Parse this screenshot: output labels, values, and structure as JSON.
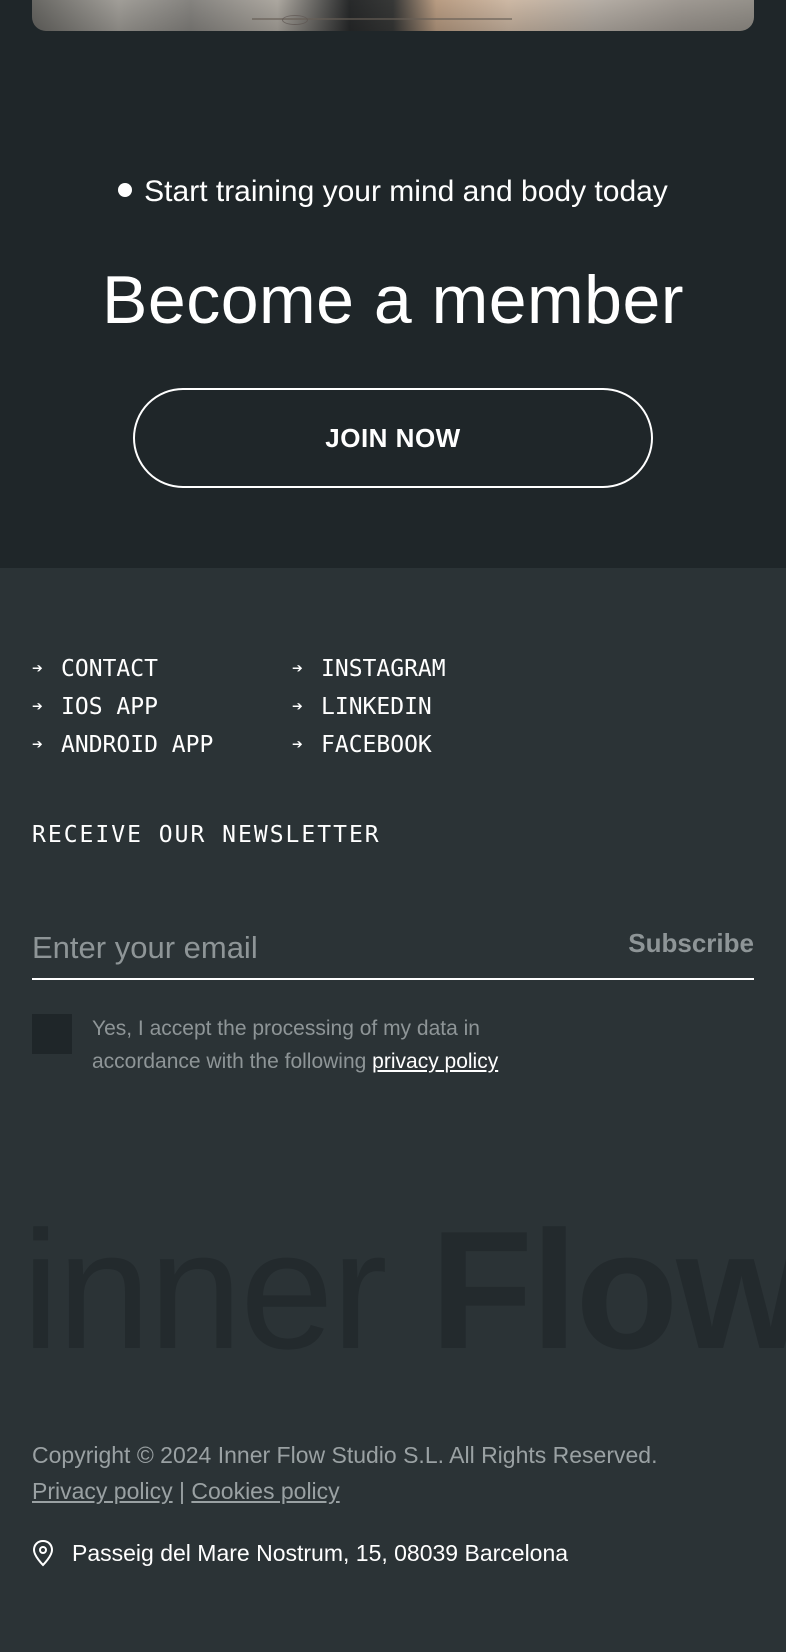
{
  "hero": {
    "eyebrow": "Start training your mind and body today",
    "headline": "Become a member",
    "cta_label": "JOIN NOW"
  },
  "footer_links": {
    "left": [
      {
        "label": "CONTACT"
      },
      {
        "label": "IOS APP"
      },
      {
        "label": "ANDROID APP"
      }
    ],
    "right": [
      {
        "label": "INSTAGRAM"
      },
      {
        "label": "LINKEDIN"
      },
      {
        "label": "FACEBOOK"
      }
    ]
  },
  "newsletter": {
    "title": "RECEIVE OUR NEWSLETTER",
    "email_placeholder": "Enter your email",
    "email_value": "",
    "subscribe_label": "Subscribe",
    "consent_text": "Yes, I accept the processing of my data in accordance with the following ",
    "consent_link": "privacy policy",
    "consent_checked": false
  },
  "brand": {
    "light": "inner",
    "bold": "Flow"
  },
  "legal": {
    "copyright": "Copyright © 2024 Inner Flow Studio S.L. All Rights Reserved.",
    "privacy_link": "Privacy policy",
    "separator": "|",
    "cookies_link": "Cookies policy"
  },
  "address": {
    "text": "Passeig del Mare Nostrum, 15, 08039 Barcelona",
    "icon": "location-pin-icon"
  },
  "colors": {
    "top_background": "#1f2629",
    "footer_background": "#2b3336",
    "muted_text": "#8e9597",
    "text": "#ffffff"
  }
}
